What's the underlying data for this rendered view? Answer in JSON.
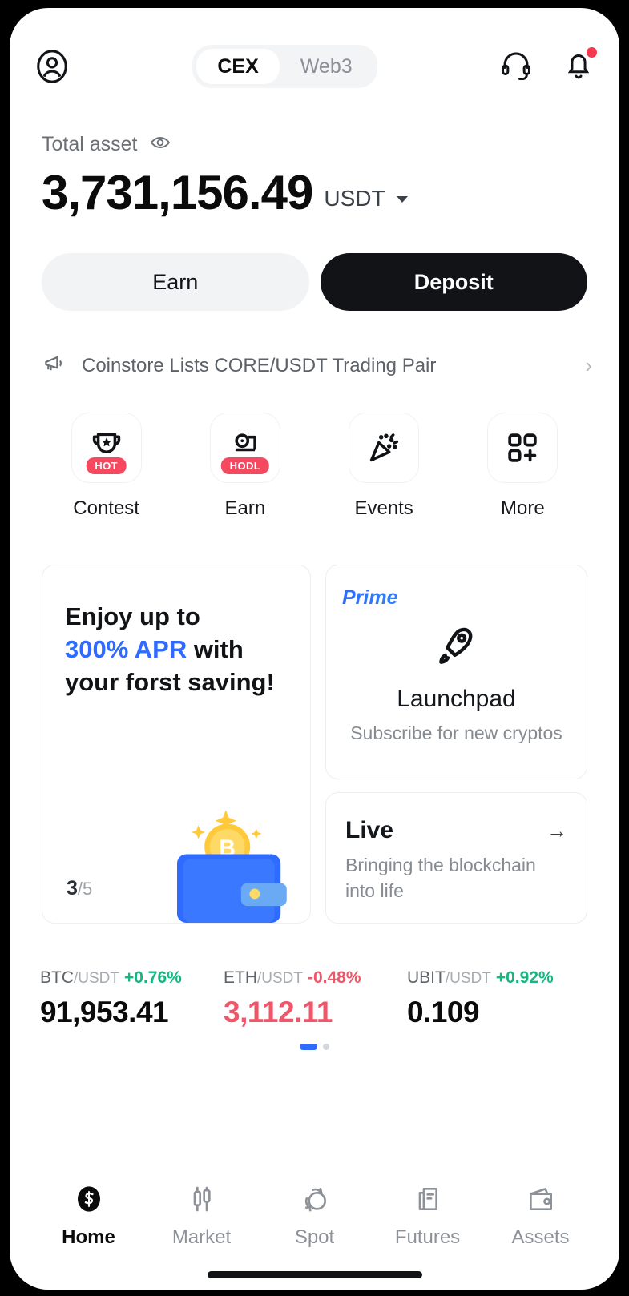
{
  "header": {
    "avatar_icon": "user-circle-icon",
    "tabs": [
      {
        "label": "CEX",
        "active": true
      },
      {
        "label": "Web3",
        "active": false
      }
    ],
    "support_icon": "headset-icon",
    "notification_icon": "bell-icon",
    "has_notification_dot": true
  },
  "balance": {
    "label": "Total asset",
    "visibility_icon": "eye-icon",
    "amount": "3,731,156.49",
    "currency": "USDT",
    "currency_caret": "chevron-down-icon"
  },
  "actions": {
    "earn_label": "Earn",
    "deposit_label": "Deposit"
  },
  "announcement": {
    "icon": "megaphone-icon",
    "text": "Coinstore Lists CORE/USDT Trading Pair",
    "chevron": "chevron-right-icon"
  },
  "quick_actions": [
    {
      "label": "Contest",
      "icon": "trophy-icon",
      "badge": "HOT"
    },
    {
      "label": "Earn",
      "icon": "hodl-coin-icon",
      "badge": "HODL"
    },
    {
      "label": "Events",
      "icon": "confetti-icon",
      "badge": ""
    },
    {
      "label": "More",
      "icon": "grid-plus-icon",
      "badge": ""
    }
  ],
  "promo_card": {
    "line1": "Enjoy up to",
    "accent": "300% APR",
    "line2_tail": " with",
    "line3": "your forst saving!",
    "counter_current": "3",
    "counter_total": "/5",
    "art": "wallet-with-bitcoin-illustration"
  },
  "prime_card": {
    "tag": "Prime",
    "icon": "rocket-icon",
    "title": "Launchpad",
    "subtitle": "Subscribe for new cryptos"
  },
  "live_card": {
    "title": "Live",
    "arrow_icon": "arrow-right-icon",
    "subtitle": "Bringing the blockchain into life"
  },
  "tickers": [
    {
      "base": "BTC",
      "quote": "/USDT",
      "change": "+0.76%",
      "direction": "up",
      "price": "91,953.41"
    },
    {
      "base": "ETH",
      "quote": "/USDT",
      "change": "-0.48%",
      "direction": "down",
      "price": "3,112.11"
    },
    {
      "base": "UBIT",
      "quote": "/USDT",
      "change": "+0.92%",
      "direction": "up",
      "price": "0.109"
    }
  ],
  "carousel": {
    "pages": 2,
    "active_index": 0,
    "active_color": "#2f6bff"
  },
  "bottom_nav": [
    {
      "label": "Home",
      "icon": "coinstore-logo-icon",
      "active": true
    },
    {
      "label": "Market",
      "icon": "candlestick-icon",
      "active": false
    },
    {
      "label": "Spot",
      "icon": "swap-circles-icon",
      "active": false
    },
    {
      "label": "Futures",
      "icon": "document-icon",
      "active": false
    },
    {
      "label": "Assets",
      "icon": "wallet-icon",
      "active": false
    }
  ],
  "colors": {
    "accent": "#2f6bff",
    "up": "#18b57f",
    "down": "#f0566a",
    "badge": "#f5495f",
    "dark": "#111317"
  }
}
